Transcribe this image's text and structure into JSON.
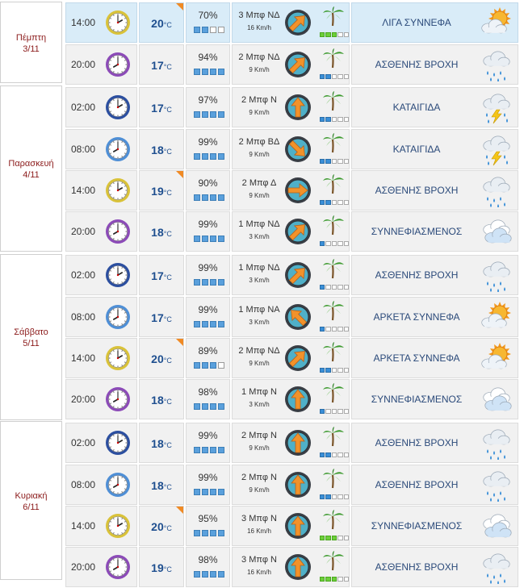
{
  "days": [
    {
      "name": "Πέμπτη",
      "date": "3/11"
    },
    {
      "name": "Παρασκευή",
      "date": "4/11"
    },
    {
      "name": "Σάββατο",
      "date": "5/11"
    },
    {
      "name": "Κυριακή",
      "date": "6/11"
    }
  ],
  "rows": [
    {
      "time": "14:00",
      "temp": "20",
      "unit": "°C",
      "hum": "70%",
      "wind": "3 Μπφ ΝΔ",
      "speed": "16 Km/h",
      "desc": "ΛΙΓΑ ΣΥΝΝΕΦΑ"
    },
    {
      "time": "20:00",
      "temp": "17",
      "unit": "°C",
      "hum": "94%",
      "wind": "2 Μπφ ΝΔ",
      "speed": "9 Km/h",
      "desc": "ΑΣΘΕΝΗΣ ΒΡΟΧΗ"
    },
    {
      "time": "02:00",
      "temp": "17",
      "unit": "°C",
      "hum": "97%",
      "wind": "2 Μπφ Ν",
      "speed": "9 Km/h",
      "desc": "ΚΑΤΑΙΓΙΔΑ"
    },
    {
      "time": "08:00",
      "temp": "18",
      "unit": "°C",
      "hum": "99%",
      "wind": "2 Μπφ ΒΔ",
      "speed": "9 Km/h",
      "desc": "ΚΑΤΑΙΓΙΔΑ"
    },
    {
      "time": "14:00",
      "temp": "19",
      "unit": "°C",
      "hum": "90%",
      "wind": "2 Μπφ Δ",
      "speed": "9 Km/h",
      "desc": "ΑΣΘΕΝΗΣ ΒΡΟΧΗ"
    },
    {
      "time": "20:00",
      "temp": "18",
      "unit": "°C",
      "hum": "99%",
      "wind": "1 Μπφ ΝΔ",
      "speed": "3 Km/h",
      "desc": "ΣΥΝΝΕΦΙΑΣΜΕΝΟΣ"
    },
    {
      "time": "02:00",
      "temp": "17",
      "unit": "°C",
      "hum": "99%",
      "wind": "1 Μπφ ΝΔ",
      "speed": "3 Km/h",
      "desc": "ΑΣΘΕΝΗΣ ΒΡΟΧΗ"
    },
    {
      "time": "08:00",
      "temp": "17",
      "unit": "°C",
      "hum": "99%",
      "wind": "1 Μπφ ΝΑ",
      "speed": "3 Km/h",
      "desc": "ΑΡΚΕΤΑ ΣΥΝΝΕΦΑ"
    },
    {
      "time": "14:00",
      "temp": "20",
      "unit": "°C",
      "hum": "89%",
      "wind": "2 Μπφ ΝΔ",
      "speed": "9 Km/h",
      "desc": "ΑΡΚΕΤΑ ΣΥΝΝΕΦΑ"
    },
    {
      "time": "20:00",
      "temp": "18",
      "unit": "°C",
      "hum": "98%",
      "wind": "1 Μπφ Ν",
      "speed": "3 Km/h",
      "desc": "ΣΥΝΝΕΦΙΑΣΜΕΝΟΣ"
    },
    {
      "time": "02:00",
      "temp": "18",
      "unit": "°C",
      "hum": "99%",
      "wind": "2 Μπφ Ν",
      "speed": "9 Km/h",
      "desc": "ΑΣΘΕΝΗΣ ΒΡΟΧΗ"
    },
    {
      "time": "08:00",
      "temp": "18",
      "unit": "°C",
      "hum": "99%",
      "wind": "2 Μπφ Ν",
      "speed": "9 Km/h",
      "desc": "ΑΣΘΕΝΗΣ ΒΡΟΧΗ"
    },
    {
      "time": "14:00",
      "temp": "20",
      "unit": "°C",
      "hum": "95%",
      "wind": "3 Μπφ Ν",
      "speed": "16 Km/h",
      "desc": "ΣΥΝΝΕΦΙΑΣΜΕΝΟΣ"
    },
    {
      "time": "20:00",
      "temp": "19",
      "unit": "°C",
      "hum": "98%",
      "wind": "3 Μπφ Ν",
      "speed": "16 Km/h",
      "desc": "ΑΣΘΕΝΗΣ ΒΡΟΧΗ"
    }
  ],
  "colors": {
    "day_label": "#8b1a1a",
    "temp": "#1f4f8f",
    "description": "#2b4a7a",
    "highlight_row": "#d9ecf8",
    "row_bg": "#f1f1f1",
    "humidity_bar": "#5aa0dc",
    "beaufort_low": "#3a8fd8",
    "beaufort_mid": "#6ccf3a",
    "warm_flag": "#f08a24"
  }
}
